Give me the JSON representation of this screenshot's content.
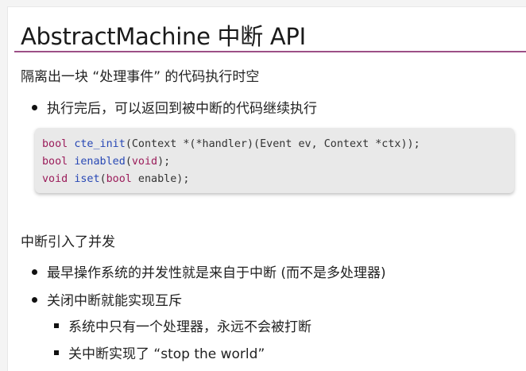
{
  "slide": {
    "title": "AbstractMachine 中断 API",
    "paragraph1": "隔离出一块 “处理事件” 的代码执行时空",
    "bullet1": "执行完后，可以返回到被中断的代码继续执行",
    "code": [
      [
        {
          "t": "bool",
          "c": "kw"
        },
        {
          "t": " ",
          "c": "tx"
        },
        {
          "t": "cte_init",
          "c": "fn"
        },
        {
          "t": "(Context *(*handler)(Event ev, Context *ctx));",
          "c": "tx"
        }
      ],
      [
        {
          "t": "bool",
          "c": "kw"
        },
        {
          "t": " ",
          "c": "tx"
        },
        {
          "t": "ienabled",
          "c": "fn"
        },
        {
          "t": "(",
          "c": "tx"
        },
        {
          "t": "void",
          "c": "kw"
        },
        {
          "t": ");",
          "c": "tx"
        }
      ],
      [
        {
          "t": "void",
          "c": "kw"
        },
        {
          "t": " ",
          "c": "tx"
        },
        {
          "t": "iset",
          "c": "fn"
        },
        {
          "t": "(",
          "c": "tx"
        },
        {
          "t": "bool",
          "c": "kw"
        },
        {
          "t": " enable);",
          "c": "tx"
        }
      ]
    ],
    "paragraph2": "中断引入了并发",
    "bullet2": "最早操作系统的并发性就是来自于中断 (而不是多处理器)",
    "bullet3": "关闭中断就能实现互斥",
    "sub1": "系统中只有一个处理器，永远不会被打断",
    "sub2": "关中断实现了 “stop the world”"
  },
  "colors": {
    "title_rule": "#9c4f86",
    "keyword": "#9b1c5a",
    "function": "#2848b5",
    "code_bg": "#e9e9e9"
  }
}
